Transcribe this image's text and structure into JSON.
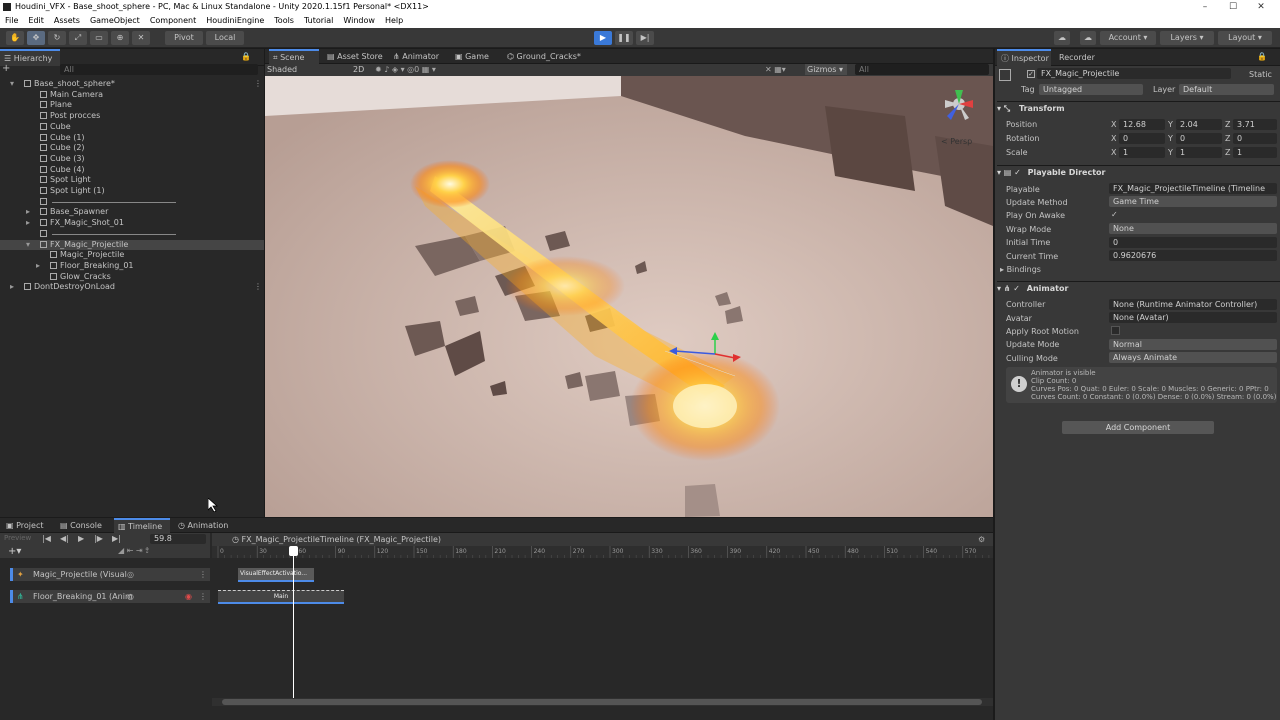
{
  "window": {
    "title": "Houdini_VFX - Base_shoot_sphere - PC, Mac & Linux Standalone - Unity 2020.1.15f1 Personal* <DX11>",
    "controls": [
      "–",
      "☐",
      "✕"
    ]
  },
  "menu": [
    "File",
    "Edit",
    "Assets",
    "GameObject",
    "Component",
    "HoudiniEngine",
    "Tools",
    "Tutorial",
    "Window",
    "Help"
  ],
  "toolbar": {
    "pivot": "Pivot",
    "local": "Local",
    "account": "Account",
    "layers": "Layers",
    "layout": "Layout"
  },
  "hierarchy": {
    "tab": "Hierarchy",
    "search_placeholder": "All",
    "items": [
      {
        "label": "Base_shoot_sphere*",
        "type": "scene"
      },
      {
        "label": "Main Camera",
        "type": "object"
      },
      {
        "label": "Plane",
        "type": "object"
      },
      {
        "label": "Post procces",
        "type": "object"
      },
      {
        "label": "Cube",
        "type": "object"
      },
      {
        "label": "Cube (1)",
        "type": "object"
      },
      {
        "label": "Cube (2)",
        "type": "object"
      },
      {
        "label": "Cube (3)",
        "type": "object"
      },
      {
        "label": "Cube (4)",
        "type": "object"
      },
      {
        "label": "Spot Light",
        "type": "object"
      },
      {
        "label": "Spot Light (1)",
        "type": "object"
      },
      {
        "label": "",
        "type": "separator"
      },
      {
        "label": "Base_Spawner",
        "type": "object"
      },
      {
        "label": "FX_Magic_Shot_01",
        "type": "object"
      },
      {
        "label": "",
        "type": "separator"
      },
      {
        "label": "FX_Magic_Projectile",
        "type": "object"
      },
      {
        "label": "Magic_Projectile",
        "type": "object"
      },
      {
        "label": "Floor_Breaking_01",
        "type": "object"
      },
      {
        "label": "Glow_Cracks",
        "type": "object"
      },
      {
        "label": "DontDestroyOnLoad",
        "type": "scene"
      }
    ]
  },
  "scene": {
    "tabs": [
      "Scene",
      "Asset Store",
      "Animator",
      "Game",
      "Ground_Cracks*"
    ],
    "shading": "Shaded",
    "mode": "2D",
    "gizmos": "Gizmos",
    "search_placeholder": "All",
    "persp": "< Persp"
  },
  "inspector": {
    "tabs": [
      "Inspector",
      "Recorder"
    ],
    "object_name": "FX_Magic_Projectile",
    "static_label": "Static",
    "tag_label": "Tag",
    "tag_value": "Untagged",
    "layer_label": "Layer",
    "layer_value": "Default",
    "transform": {
      "title": "Transform",
      "position_label": "Position",
      "position": {
        "x": "12.68",
        "y": "2.04",
        "z": "3.71"
      },
      "rotation_label": "Rotation",
      "rotation": {
        "x": "0",
        "y": "0",
        "z": "0"
      },
      "scale_label": "Scale",
      "scale": {
        "x": "1",
        "y": "1",
        "z": "1"
      }
    },
    "playable_director": {
      "title": "Playable Director",
      "playable_label": "Playable",
      "playable_value": "FX_Magic_ProjectileTimeline (Timeline",
      "update_method_label": "Update Method",
      "update_method_value": "Game Time",
      "play_on_awake_label": "Play On Awake",
      "play_on_awake_value": "✓",
      "wrap_mode_label": "Wrap Mode",
      "wrap_mode_value": "None",
      "initial_time_label": "Initial Time",
      "initial_time_value": "0",
      "current_time_label": "Current Time",
      "current_time_value": "0.9620676",
      "bindings_label": "Bindings"
    },
    "animator": {
      "title": "Animator",
      "controller_label": "Controller",
      "controller_value": "None (Runtime Animator Controller)",
      "avatar_label": "Avatar",
      "avatar_value": "None (Avatar)",
      "apply_root_motion_label": "Apply Root Motion",
      "update_mode_label": "Update Mode",
      "update_mode_value": "Normal",
      "culling_mode_label": "Culling Mode",
      "culling_mode_value": "Always Animate",
      "info_lines": [
        "Animator is visible",
        "Clip Count: 0",
        "Curves Pos: 0 Quat: 0 Euler: 0 Scale: 0 Muscles: 0 Generic: 0 PPtr: 0",
        "Curves Count: 0 Constant: 0 (0.0%) Dense: 0 (0.0%) Stream: 0 (0.0%)"
      ]
    },
    "add_component": "Add Component"
  },
  "bottom": {
    "tabs": [
      "Project",
      "Console",
      "Timeline",
      "Animation"
    ],
    "preview_label": "Preview",
    "frame": "59.8",
    "timeline_asset": "FX_Magic_ProjectileTimeline (FX_Magic_Projectile)",
    "ruler": [
      "0",
      "30",
      "60",
      "90",
      "120",
      "150",
      "180",
      "210",
      "240",
      "270",
      "300",
      "330",
      "360",
      "390",
      "420",
      "450",
      "480",
      "510",
      "540",
      "570"
    ],
    "tracks": [
      {
        "label": "Magic_Projectile (Visual",
        "clip": "VisualEffectActivatio..."
      },
      {
        "label": "Floor_Breaking_01 (Anim",
        "clip": "Main"
      }
    ],
    "colors": {
      "playhead": "#ffffff",
      "accent": "#4d8be8",
      "record": "#e04a4a"
    }
  }
}
